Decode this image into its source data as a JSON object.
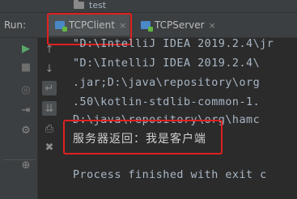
{
  "breadcrumb": {
    "project_name": "test",
    "folder_icon": "folder-icon"
  },
  "run_panel": {
    "label": "Run:",
    "tabs": [
      {
        "label": "TCPClient",
        "close": "×",
        "active": true,
        "icon": "run-config-icon"
      },
      {
        "label": "TCPServer",
        "close": "×",
        "active": false,
        "icon": "run-config-icon"
      }
    ]
  },
  "toolbar": {
    "tools": [
      {
        "name": "rerun-icon",
        "glyph": "▶"
      },
      {
        "name": "stop-icon",
        "glyph": "■"
      },
      {
        "name": "camera-icon",
        "glyph": "◎"
      },
      {
        "name": "exit-icon",
        "glyph": "⇥"
      },
      {
        "name": "settings-icon",
        "glyph": "⚙"
      },
      {
        "name": "pin-icon",
        "glyph": "⊕"
      },
      {
        "name": "up-arrow-icon",
        "glyph": "↑"
      },
      {
        "name": "down-arrow-icon",
        "glyph": "↓"
      },
      {
        "name": "soft-wrap-icon",
        "glyph": "↵"
      },
      {
        "name": "scroll-to-end-icon",
        "glyph": "⇊"
      },
      {
        "name": "print-icon",
        "glyph": "⎙"
      },
      {
        "name": "trash-icon",
        "glyph": "🗑"
      }
    ]
  },
  "console": {
    "lines": [
      "\"D:\\IntelliJ IDEA 2019.2.4\\jr",
      "\"D:\\IntelliJ IDEA 2019.2.4\\",
      ".jar;D:\\java\\repository\\org",
      ".50\\kotlin-stdlib-common-1.",
      "D:\\java\\repository\\org\\hamc"
    ],
    "output_line": "服务器返回：我是客户端",
    "process_line": "Process finished with exit c"
  },
  "colors": {
    "background": "#2b2b2b",
    "panel": "#3c3f41",
    "text": "#a9b7c6",
    "highlight": "#e02020",
    "run_green": "#59a869"
  }
}
